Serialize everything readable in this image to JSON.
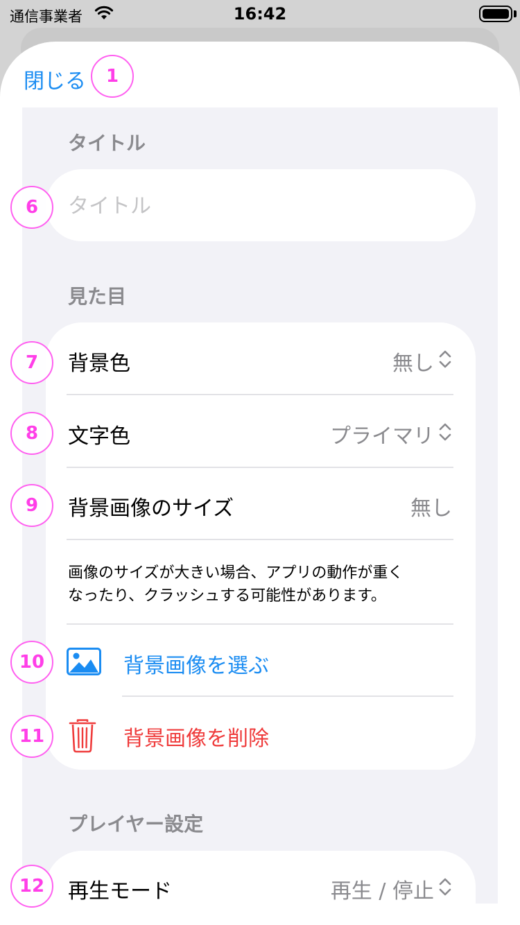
{
  "status_bar": {
    "carrier": "通信事業者",
    "time": "16:42"
  },
  "sheet": {
    "close_label": "閉じる"
  },
  "title_section": {
    "header": "タイトル",
    "placeholder": "タイトル",
    "value": ""
  },
  "appearance": {
    "header": "見た目",
    "rows": [
      {
        "label": "背景色",
        "value": "無し"
      },
      {
        "label": "文字色",
        "value": "プライマリ"
      },
      {
        "label": "背景画像のサイズ",
        "value": "無し"
      }
    ],
    "note_line1": "画像のサイズが大きい場合、アプリの動作が重く",
    "note_line2": "なったり、クラッシュする可能性があります。",
    "choose_image_label": "背景画像を選ぶ",
    "delete_image_label": "背景画像を削除"
  },
  "player": {
    "header": "プレイヤー設定",
    "rows": [
      {
        "label": "再生モード",
        "value": "再生 / 停止"
      }
    ]
  },
  "markers": [
    "1",
    "6",
    "7",
    "8",
    "9",
    "10",
    "11",
    "12"
  ],
  "icons": {
    "wifi": "wifi-icon",
    "battery": "battery-icon",
    "chevron": "up-down-chevron-icon",
    "photo": "photo-icon",
    "trash": "trash-icon"
  },
  "colors": {
    "accent": "#1a8cf2",
    "destructive": "#ef3b3b",
    "marker": "#ff3ee8",
    "grouped_background": "#f2f2f7"
  }
}
